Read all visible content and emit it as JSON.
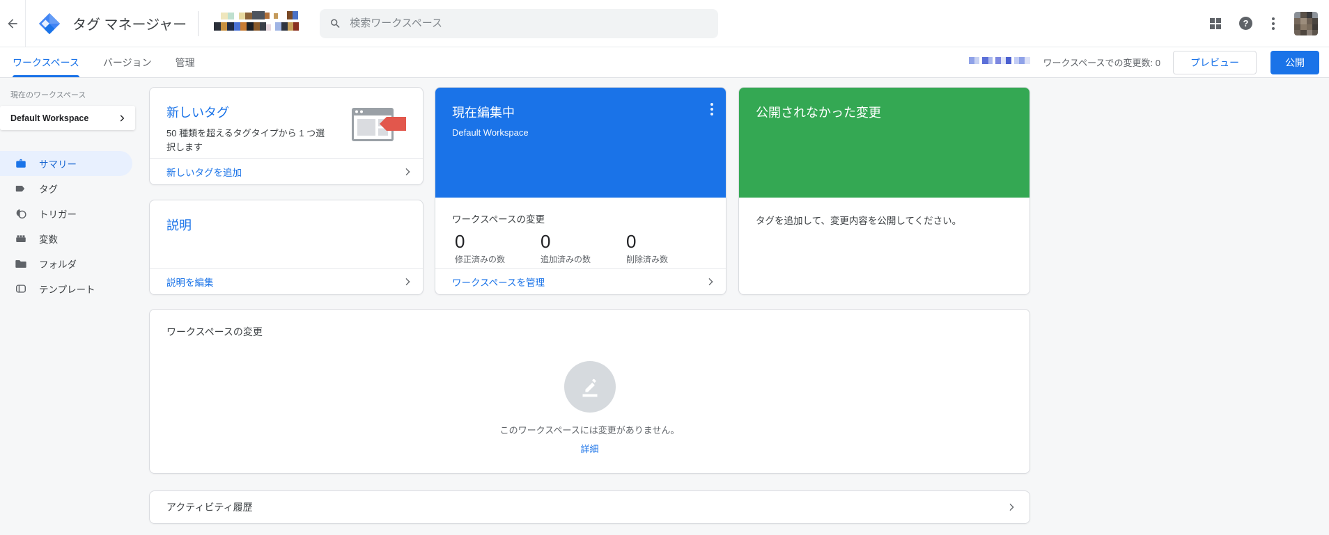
{
  "header": {
    "title": "タグ マネージャー",
    "search_placeholder": "検索ワークスペース"
  },
  "icons": {
    "help_glyph": "?"
  },
  "tabs": {
    "workspace": "ワークスペース",
    "versions": "バージョン",
    "admin": "管理"
  },
  "actions": {
    "changes_count_label": "ワークスペースでの変更数: 0",
    "preview": "プレビュー",
    "publish": "公開"
  },
  "sidebar": {
    "current_workspace_label": "現在のワークスペース",
    "workspace_name": "Default Workspace",
    "items": [
      {
        "label": "サマリー"
      },
      {
        "label": "タグ"
      },
      {
        "label": "トリガー"
      },
      {
        "label": "変数"
      },
      {
        "label": "フォルダ"
      },
      {
        "label": "テンプレート"
      }
    ]
  },
  "new_tag_card": {
    "title": "新しいタグ",
    "description": "50 種類を超えるタグタイプから 1 つ選択します",
    "action": "新しいタグを追加"
  },
  "editing_card": {
    "title": "現在編集中",
    "subtitle": "Default Workspace",
    "stats_heading": "ワークスペースの変更",
    "stats": [
      {
        "value": "0",
        "label": "修正済みの数"
      },
      {
        "value": "0",
        "label": "追加済みの数"
      },
      {
        "value": "0",
        "label": "削除済み数"
      }
    ],
    "action": "ワークスペースを管理"
  },
  "unpublished_card": {
    "title": "公開されなかった変更",
    "body": "タグを追加して、変更内容を公開してください。"
  },
  "description_card": {
    "title": "説明",
    "action": "説明を編集"
  },
  "changes_panel": {
    "title": "ワークスペースの変更",
    "empty_message": "このワークスペースには変更がありません。",
    "details_link": "詳細"
  },
  "activity_panel": {
    "title": "アクティビティ履歴"
  },
  "colors": {
    "accent_blue": "#1a73e8",
    "header_green": "#34a853",
    "active_item_bg": "#e8f0fe",
    "tag_red": "#e2574c"
  }
}
